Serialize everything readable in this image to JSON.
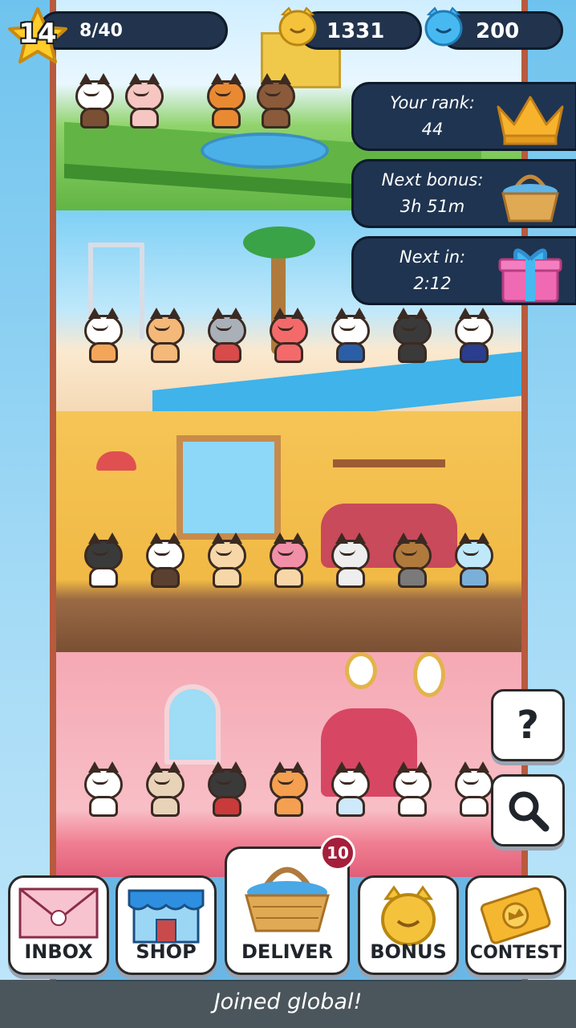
{
  "hud": {
    "level": "14",
    "level_progress": "8/40",
    "coins": "1331",
    "gems": "200"
  },
  "panels": {
    "rank_label": "Your rank:",
    "rank_value": "44",
    "bonus_label": "Next bonus:",
    "bonus_value": "3h 51m",
    "next_label": "Next in:",
    "next_value": "2:12"
  },
  "side_buttons": {
    "help_glyph": "?"
  },
  "nav": {
    "inbox": "INBOX",
    "shop": "SHOP",
    "deliver": "DELIVER",
    "deliver_badge": "10",
    "bonus": "BONUS",
    "contest": "CONTEST"
  },
  "toast": "Joined global!",
  "colors": {
    "accent_navy": "#22334d",
    "badge_red": "#a51e3a",
    "coin_gold": "#f5c33b",
    "gem_blue": "#47b9f0"
  }
}
